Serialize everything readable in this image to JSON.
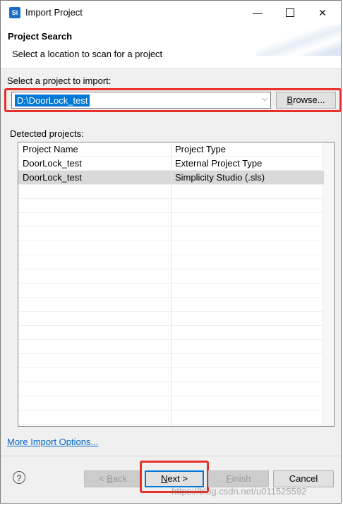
{
  "window": {
    "title": "Import Project",
    "app_icon_text": "Si",
    "minimize_glyph": "—",
    "close_glyph": "✕"
  },
  "banner": {
    "title": "Project Search",
    "subtitle": "Select a location to scan for a project"
  },
  "select_section": {
    "label": "Select a project to import:",
    "path_value": "D:\\DoorLock_test",
    "dropdown_glyph": "⌵",
    "browse_label_mn": "B",
    "browse_label_rest": "rowse..."
  },
  "detected": {
    "label": "Detected projects:",
    "columns": [
      "Project Name",
      "Project Type"
    ],
    "rows": [
      {
        "name": "DoorLock_test",
        "type": "External Project Type",
        "selected": false
      },
      {
        "name": "DoorLock_test",
        "type": "Simplicity Studio (.sls)",
        "selected": true
      }
    ]
  },
  "more_options_link": "More Import Options...",
  "buttons": {
    "back_mn": "B",
    "back_pre": "< ",
    "back_rest": "ack",
    "next_mn": "N",
    "next_rest": "ext >",
    "finish_mn": "F",
    "finish_rest": "inish",
    "cancel": "Cancel"
  },
  "help_glyph": "?",
  "watermark": "https://blog.csdn.net/u011525592",
  "colors": {
    "highlight": "#e8302a",
    "selection": "#0078d7",
    "link": "#0066cc"
  }
}
